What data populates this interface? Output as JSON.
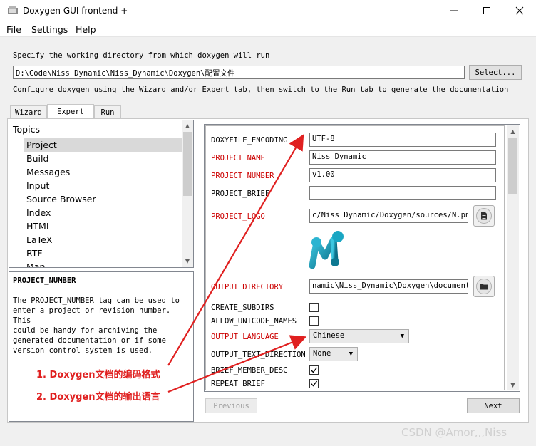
{
  "window": {
    "title": "Doxygen GUI frontend +",
    "icons": {
      "app": "doxygen-app-icon",
      "minimize": "minimize-icon",
      "maximize": "maximize-icon",
      "close": "close-icon"
    }
  },
  "menu": {
    "file": "File",
    "settings": "Settings",
    "help": "Help"
  },
  "header": {
    "workdir_label": "Specify the working directory from which doxygen will run",
    "workdir_value": "D:\\Code\\Niss Dynamic\\Niss_Dynamic\\Doxygen\\配置文件",
    "select_button": "Select...",
    "configure_text": "Configure doxygen using the Wizard and/or Expert tab, then switch to the Run tab to generate the documentation"
  },
  "tabs": [
    {
      "label": "Wizard",
      "active": false
    },
    {
      "label": "Expert",
      "active": true
    },
    {
      "label": "Run",
      "active": false
    }
  ],
  "topics": {
    "title": "Topics",
    "items": [
      "Project",
      "Build",
      "Messages",
      "Input",
      "Source Browser",
      "Index",
      "HTML",
      "LaTeX",
      "RTF",
      "Man"
    ],
    "selected": "Project"
  },
  "help": {
    "title": "PROJECT_NUMBER",
    "lines": [
      "The PROJECT_NUMBER tag can be used to",
      "enter a project or revision number. This",
      "could be handy for archiving the",
      "generated documentation or if some",
      "version control system is used."
    ]
  },
  "settings": {
    "doxyfile_encoding": {
      "label": "DOXYFILE_ENCODING",
      "value": "UTF-8"
    },
    "project_name": {
      "label": "PROJECT_NAME",
      "value": "Niss Dynamic"
    },
    "project_number": {
      "label": "PROJECT_NUMBER",
      "value": "v1.00"
    },
    "project_brief": {
      "label": "PROJECT_BRIEF",
      "value": ""
    },
    "project_logo": {
      "label": "PROJECT_LOGO",
      "value": "c/Niss_Dynamic/Doxygen/sources/N.png",
      "button_icon": "file-icon"
    },
    "output_directory": {
      "label": "OUTPUT_DIRECTORY",
      "value": "namic\\Niss_Dynamic\\Doxygen\\documents",
      "button_icon": "folder-icon"
    },
    "create_subdirs": {
      "label": "CREATE_SUBDIRS",
      "checked": false
    },
    "allow_unicode_names": {
      "label": "ALLOW_UNICODE_NAMES",
      "checked": false
    },
    "output_language": {
      "label": "OUTPUT_LANGUAGE",
      "value": "Chinese"
    },
    "output_text_direction": {
      "label": "OUTPUT_TEXT_DIRECTION",
      "value": "None"
    },
    "brief_member_desc": {
      "label": "BRIEF_MEMBER_DESC",
      "checked": true
    },
    "repeat_brief": {
      "label": "REPEAT_BRIEF",
      "checked": true
    }
  },
  "nav": {
    "previous": "Previous",
    "next": "Next"
  },
  "annotations": {
    "a1": "1. Doxygen文档的编码格式",
    "a2": "2. Doxygen文档的输出语言",
    "color": "#e02020"
  },
  "watermark": "CSDN @Amor,,,Niss",
  "colors": {
    "required_label": "#cc0000",
    "logo_teal": "#1a9fb8"
  }
}
